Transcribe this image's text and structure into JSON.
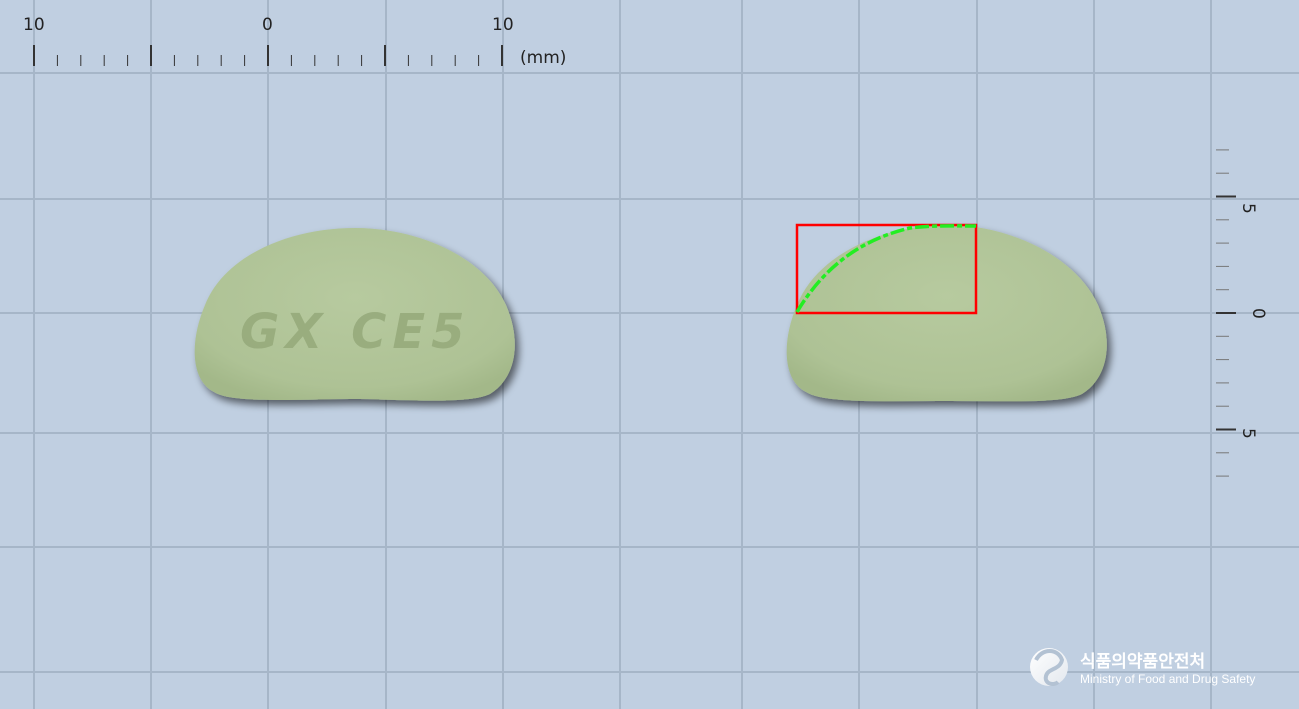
{
  "ruler_top": {
    "labels": [
      "10",
      "0",
      "10"
    ],
    "unit": "(mm)"
  },
  "ruler_right": {
    "labels": [
      "5",
      "0",
      "5"
    ]
  },
  "tablet_front": {
    "imprint": "GX CE5",
    "color": "#b4c79d"
  },
  "tablet_back": {
    "color": "#b4c79d"
  },
  "annotation": {
    "box_color": "#ff0000",
    "curve_color": "#22ee22"
  },
  "logo": {
    "korean": "식품의약품안전처",
    "english": "Ministry of Food and Drug Safety"
  }
}
